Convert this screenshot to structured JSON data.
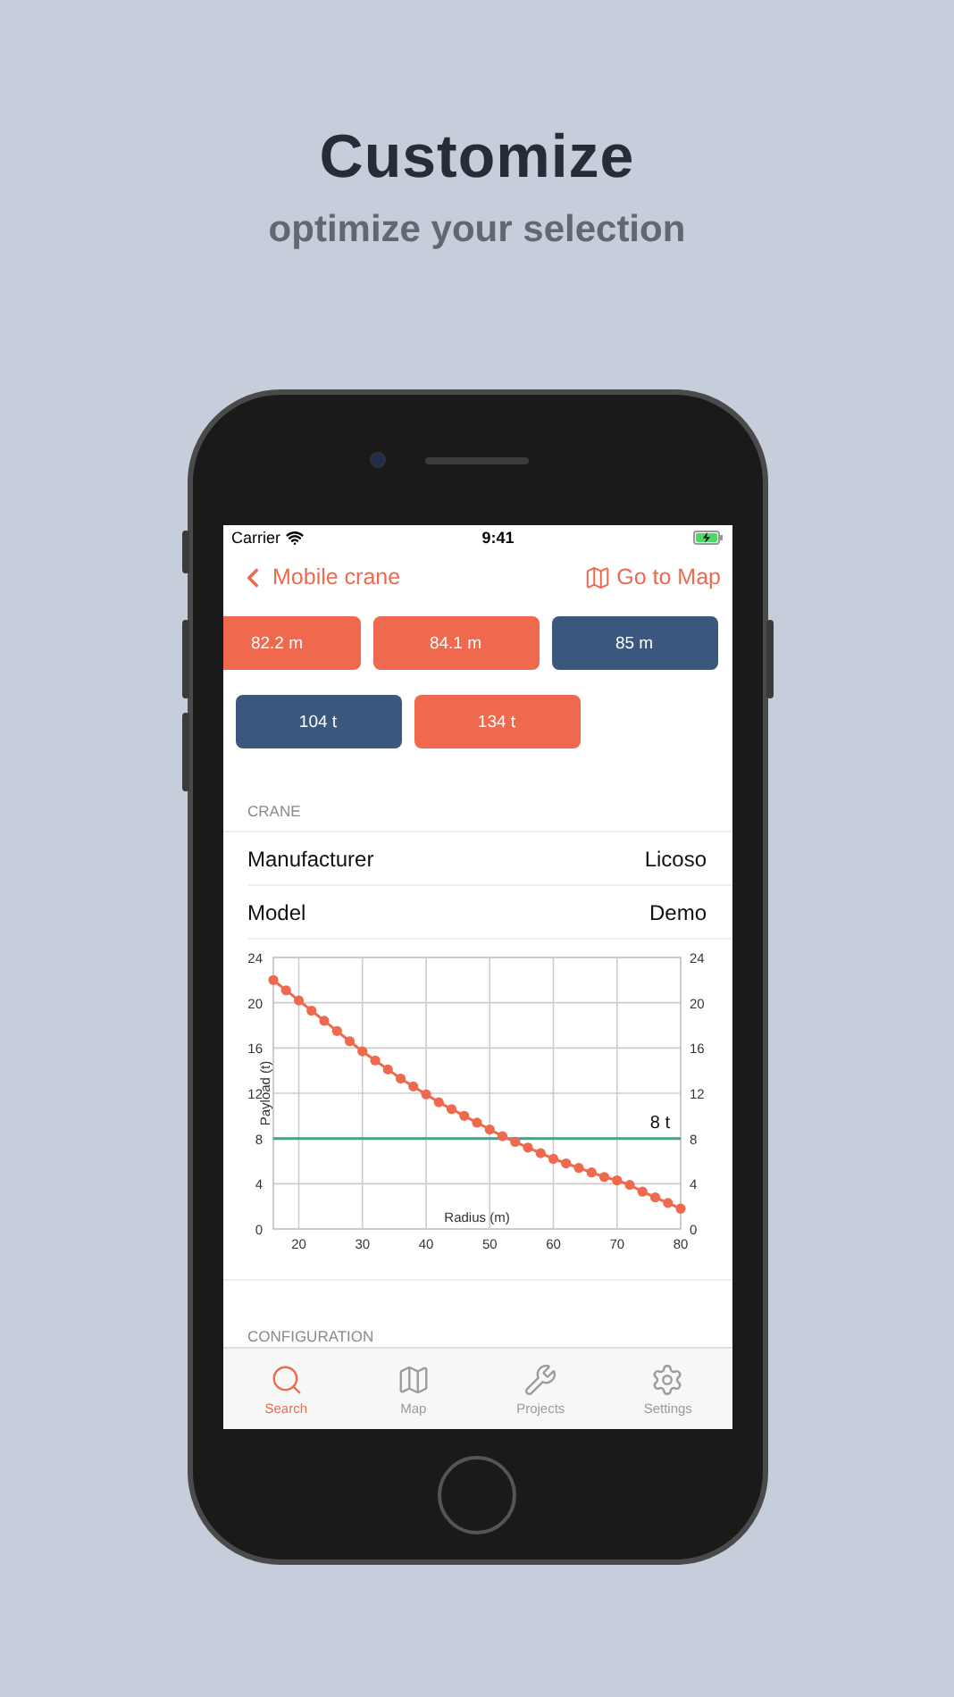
{
  "headline": {
    "title": "Customize",
    "subtitle": "optimize your selection"
  },
  "status_bar": {
    "carrier": "Carrier",
    "time": "9:41"
  },
  "nav_bar": {
    "back_label": "Mobile crane",
    "action_label": "Go to Map"
  },
  "option_rows": [
    [
      {
        "label": "82.2 m",
        "selected": false
      },
      {
        "label": "84.1 m",
        "selected": false
      },
      {
        "label": "85 m",
        "selected": true
      }
    ],
    [
      {
        "label": "104 t",
        "selected": true
      },
      {
        "label": "134 t",
        "selected": false
      }
    ]
  ],
  "crane_section": {
    "header": "CRANE",
    "rows": [
      {
        "label": "Manufacturer",
        "value": "Licoso"
      },
      {
        "label": "Model",
        "value": "Demo"
      }
    ]
  },
  "load_chart": {
    "limit_label": "8 t",
    "left_axis_ticks": [
      "24",
      "20",
      "16",
      "12",
      "8",
      "4",
      "0"
    ],
    "right_axis_ticks": [
      "24",
      "20",
      "16",
      "12",
      "8",
      "4",
      "0"
    ],
    "chart_data": {
      "type": "line",
      "grid": true,
      "xlabel": "Radius (m)",
      "ylabel": "Payload (t)",
      "xlim": [
        16,
        80
      ],
      "ylim": [
        0,
        24
      ],
      "xticks": [
        20,
        30,
        40,
        50,
        60,
        70,
        80
      ],
      "yticks": [
        0,
        4,
        8,
        12,
        16,
        20,
        24
      ],
      "x": [
        16,
        18,
        20,
        22,
        24,
        26,
        28,
        30,
        32,
        34,
        36,
        38,
        40,
        42,
        44,
        46,
        48,
        50,
        52,
        54,
        56,
        58,
        60,
        62,
        64,
        66,
        68,
        70,
        72,
        74,
        76,
        78,
        80
      ],
      "series": [
        {
          "color": "#ee694d",
          "marker": "circle",
          "values": [
            22,
            21.1,
            20.2,
            19.3,
            18.4,
            17.5,
            16.6,
            15.7,
            14.9,
            14.1,
            13.3,
            12.6,
            11.9,
            11.2,
            10.6,
            10,
            9.4,
            8.8,
            8.2,
            7.7,
            7.2,
            6.7,
            6.2,
            5.8,
            5.4,
            5,
            4.6,
            4.3,
            3.9,
            3.3,
            2.8,
            2.3,
            1.8
          ]
        },
        {
          "color": "#3aa786",
          "values": [
            8,
            8,
            8,
            8,
            8,
            8,
            8,
            8,
            8,
            8,
            8,
            8,
            8,
            8,
            8,
            8,
            8,
            8,
            8,
            8,
            8,
            8,
            8,
            8,
            8,
            8,
            8,
            8,
            8,
            8,
            8,
            8,
            8
          ]
        }
      ]
    }
  },
  "configuration_section": {
    "header": "CONFIGURATION"
  },
  "tab_bar": [
    {
      "label": "Search",
      "selected": true
    },
    {
      "label": "Map",
      "selected": false
    },
    {
      "label": "Projects",
      "selected": false
    },
    {
      "label": "Settings",
      "selected": false
    }
  ]
}
